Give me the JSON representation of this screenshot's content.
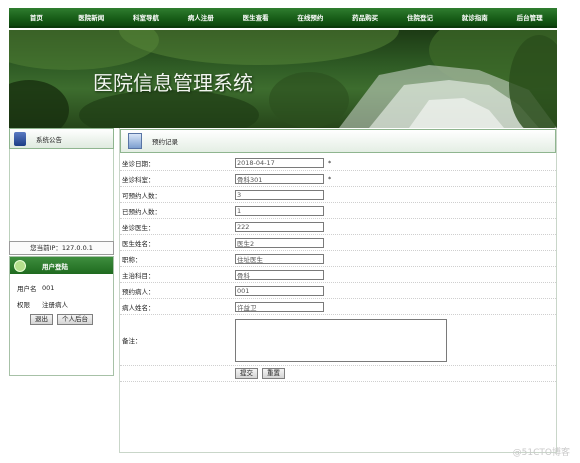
{
  "nav": [
    "首页",
    "医院新闻",
    "科室导航",
    "病人注册",
    "医生查看",
    "在线预约",
    "药品购买",
    "住院登记",
    "就诊指南",
    "后台管理"
  ],
  "banner": {
    "title": "医院信息管理系统",
    "sky_color": "#2e5a24"
  },
  "sidebar": {
    "notice_title": "系统公告",
    "ip_label": "您当前IP：127.0.0.1",
    "login_title": "用户登陆",
    "user_label": "用户名",
    "user_value": "001",
    "role_label": "权限",
    "role_value": "注册病人",
    "logout_button": "退出",
    "backend_button": "个人后台"
  },
  "main": {
    "title": "预约记录",
    "fields": [
      {
        "label": "坐诊日期：",
        "value": "2018-04-17",
        "required": "*"
      },
      {
        "label": "坐诊科室：",
        "value": "骨科301",
        "required": "*"
      },
      {
        "label": "可预约人数：",
        "value": "3",
        "required": ""
      },
      {
        "label": "已预约人数：",
        "value": "1",
        "required": ""
      },
      {
        "label": "坐诊医生：",
        "value": "222",
        "required": ""
      },
      {
        "label": "医生姓名：",
        "value": "医生2",
        "required": ""
      },
      {
        "label": "职称：",
        "value": "住址医生",
        "required": ""
      },
      {
        "label": "主治科目：",
        "value": "骨科",
        "required": ""
      },
      {
        "label": "预约病人：",
        "value": "001",
        "required": ""
      },
      {
        "label": "病人姓名：",
        "value": "许益卫",
        "required": ""
      }
    ],
    "remark_label": "备注：",
    "remark_value": "",
    "submit_button": "提交",
    "reset_button": "重置"
  },
  "watermark": "@51CTO博客",
  "colors": {
    "nav_green": "#175c17",
    "accent": "#2f7d2f"
  }
}
